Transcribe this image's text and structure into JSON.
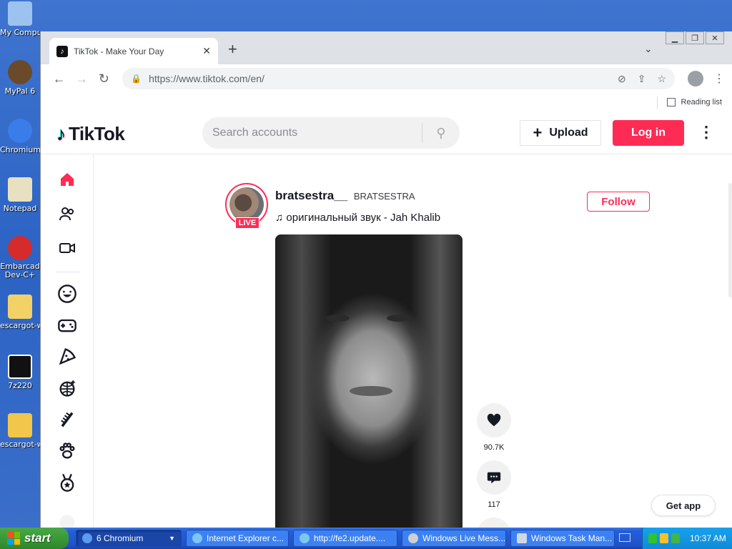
{
  "desktop": {
    "icons": [
      {
        "label": "My Computer",
        "color": "#9cc3f0"
      },
      {
        "label": "MyPal 6",
        "color": "#6b4a2a"
      },
      {
        "label": "Chromium",
        "color": "#3b7de8"
      },
      {
        "label": "Notepad",
        "color": "#e8e0c0"
      },
      {
        "label": "Embarcad Dev-C+",
        "color": "#d62b2b"
      },
      {
        "label": "escargot-w",
        "color": "#f2d267"
      },
      {
        "label": "7z220",
        "color": "#111111"
      },
      {
        "label": "escargot-w",
        "color": "#f2c64a"
      }
    ]
  },
  "browser": {
    "tab_title": "TikTok - Make Your Day",
    "url": "https://www.tiktok.com/en/",
    "reading_list": "Reading list"
  },
  "tiktok": {
    "logo": "TikTok",
    "search_placeholder": "Search accounts",
    "upload_label": "Upload",
    "login_label": "Log in",
    "post": {
      "username": "bratsestra__",
      "nickname": "BRATSESTRA",
      "live_badge": "LIVE",
      "music": "оригинальный звук - Jah Khalib",
      "follow_label": "Follow",
      "likes": "90.7K",
      "comments": "117"
    },
    "get_app": "Get app"
  },
  "taskbar": {
    "start_label": "start",
    "tasks": [
      {
        "label": "6 Chromium",
        "active": true
      },
      {
        "label": "Internet Explorer c...",
        "active": false
      },
      {
        "label": "http://fe2.update....",
        "active": false
      },
      {
        "label": "Windows Live Mess...",
        "active": false
      },
      {
        "label": "Windows Task Man...",
        "active": false
      }
    ],
    "clock": "10:37 AM"
  },
  "colors": {
    "tiktok_accent": "#fe2c55",
    "xp_blue": "#245edb",
    "xp_start": "#3a9a36"
  }
}
